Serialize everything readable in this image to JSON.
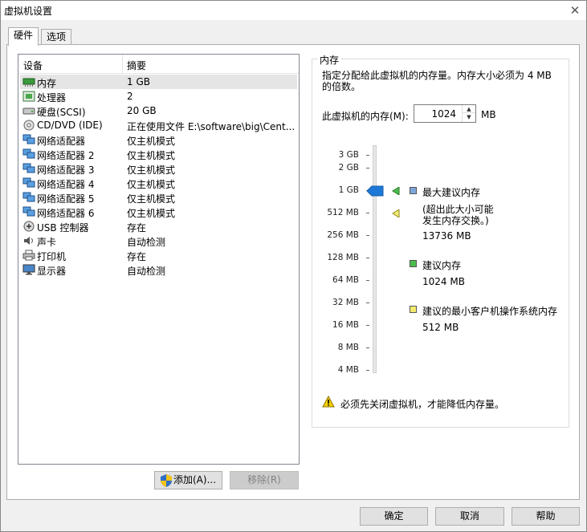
{
  "window": {
    "title": "虚拟机设置",
    "close_glyph": "✕"
  },
  "tabs": [
    {
      "label": "硬件",
      "active": true
    },
    {
      "label": "选项",
      "active": false
    }
  ],
  "devices": {
    "columns": [
      "设备",
      "摘要"
    ],
    "items": [
      {
        "name": "内存",
        "summary": "1 GB",
        "icon": "memory-icon",
        "selected": true
      },
      {
        "name": "处理器",
        "summary": "2",
        "icon": "processor-icon"
      },
      {
        "name": "硬盘(SCSI)",
        "summary": "20 GB",
        "icon": "hard-disk-icon"
      },
      {
        "name": "CD/DVD (IDE)",
        "summary": "正在使用文件 E:\\software\\big\\Cent...",
        "icon": "cd-dvd-icon"
      },
      {
        "name": "网络适配器",
        "summary": "仅主机模式",
        "icon": "network-adapter-icon"
      },
      {
        "name": "网络适配器 2",
        "summary": "仅主机模式",
        "icon": "network-adapter-icon"
      },
      {
        "name": "网络适配器 3",
        "summary": "仅主机模式",
        "icon": "network-adapter-icon"
      },
      {
        "name": "网络适配器 4",
        "summary": "仅主机模式",
        "icon": "network-adapter-icon"
      },
      {
        "name": "网络适配器 5",
        "summary": "仅主机模式",
        "icon": "network-adapter-icon"
      },
      {
        "name": "网络适配器 6",
        "summary": "仅主机模式",
        "icon": "network-adapter-icon"
      },
      {
        "name": "USB 控制器",
        "summary": "存在",
        "icon": "usb-icon"
      },
      {
        "name": "声卡",
        "summary": "自动检测",
        "icon": "sound-card-icon"
      },
      {
        "name": "打印机",
        "summary": "存在",
        "icon": "printer-icon"
      },
      {
        "name": "显示器",
        "summary": "自动检测",
        "icon": "display-icon"
      }
    ],
    "add_label": "添加(A)...",
    "remove_label": "移除(R)"
  },
  "memory": {
    "group_title": "内存",
    "description": "指定分配给此虚拟机的内存量。内存大小必须为 4 MB 的倍数。",
    "field_label": "此虚拟机的内存(M):",
    "value": "1024",
    "unit": "MB",
    "scale_labels": [
      "3 GB",
      "2 GB",
      "1 GB",
      "512 MB",
      "256 MB",
      "128 MB",
      "64 MB",
      "32 MB",
      "16 MB",
      "8 MB",
      "4 MB"
    ],
    "max_label": "最大建议内存",
    "max_note_1": "(超出此大小可能",
    "max_note_2": "发生内存交换。)",
    "max_value": "13736 MB",
    "rec_label": "建议内存",
    "rec_value": "1024 MB",
    "min_label": "建议的最小客户机操作系统内存",
    "min_value": "512 MB",
    "warning": "必须先关闭虚拟机，才能降低内存量。",
    "colors": {
      "max": "#7ea6d8",
      "recommended": "#4cbb4c",
      "minimum": "#f3ea6e",
      "slider": "#1e78d7"
    }
  },
  "footer": {
    "ok": "确定",
    "cancel": "取消",
    "help": "帮助"
  }
}
